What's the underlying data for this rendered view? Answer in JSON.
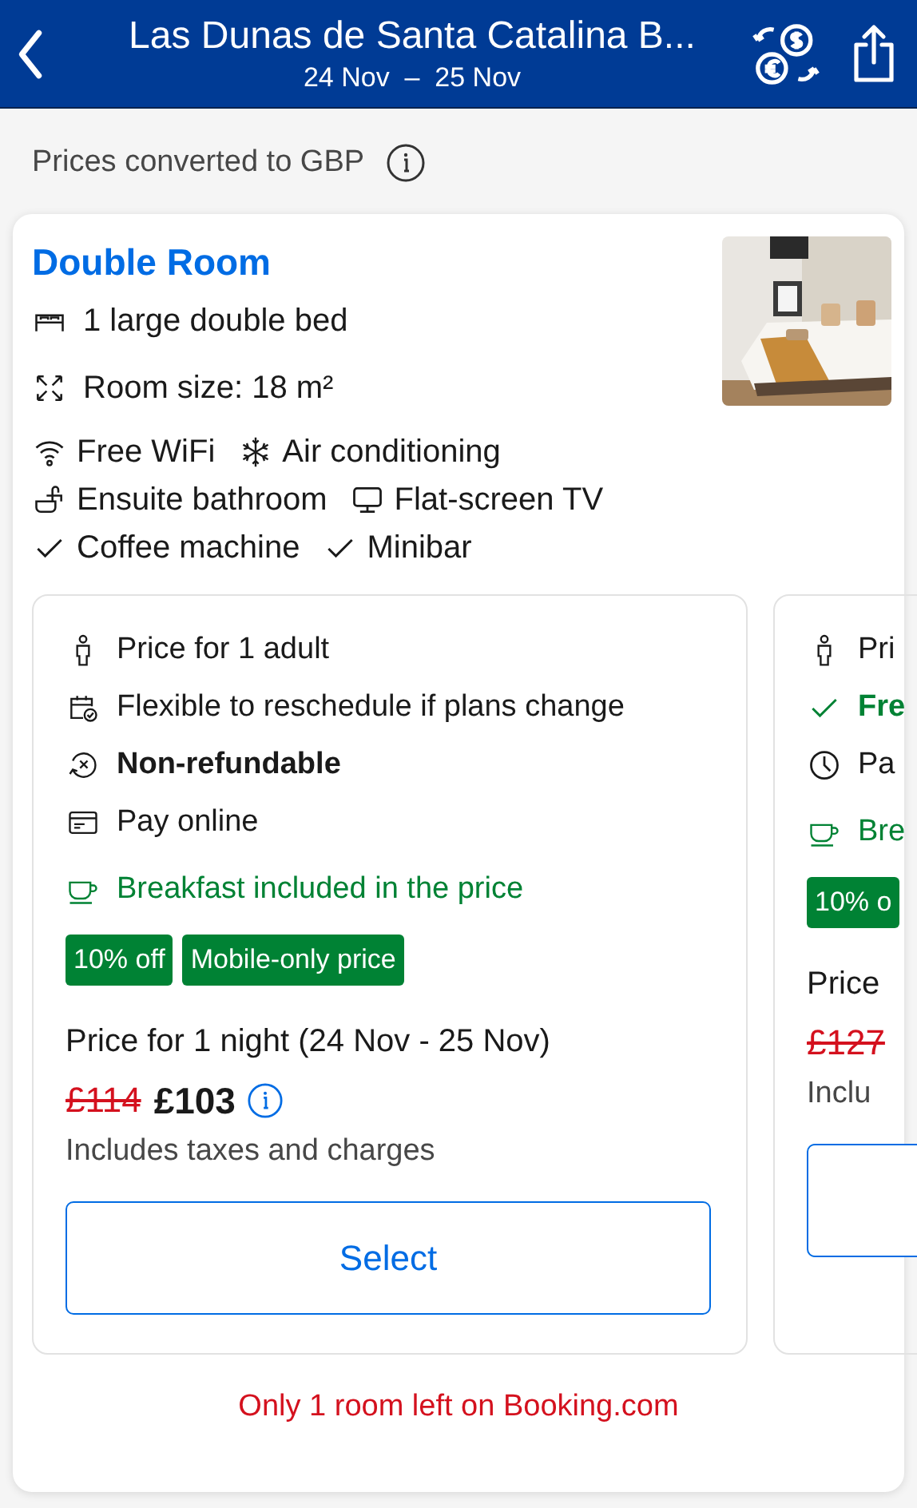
{
  "header": {
    "title": "Las Dunas de Santa Catalina B...",
    "dates": "24 Nov  –  25 Nov"
  },
  "notice": {
    "text": "Prices converted to GBP"
  },
  "room": {
    "name": "Double Room",
    "photo": {
      "kind": "picture"
    },
    "facilities": [
      {
        "kind": "bed",
        "text": "1 large double bed"
      },
      {
        "kind": "size",
        "text": "Room size: 18 m²"
      }
    ],
    "amenity_rows": [
      [
        {
          "kind": "wifi",
          "text": "Free WiFi"
        },
        {
          "kind": "snow",
          "text": "Air conditioning"
        }
      ],
      [
        {
          "kind": "bath",
          "text": "Ensuite bathroom"
        },
        {
          "kind": "tv",
          "text": "Flat-screen TV"
        }
      ],
      [
        {
          "kind": "check",
          "text": "Coffee machine"
        },
        {
          "kind": "check",
          "text": "Minibar"
        }
      ]
    ],
    "offers": [
      {
        "conditions": [
          {
            "kind": "person",
            "text": "Price for 1 adult",
            "bold": false,
            "positive": false
          },
          {
            "kind": "calendar",
            "text": "Flexible to reschedule if plans change",
            "bold": false,
            "positive": false
          },
          {
            "kind": "norefund",
            "text": "Non-refundable",
            "bold": true,
            "positive": false
          },
          {
            "kind": "card",
            "text": "Pay online",
            "bold": false,
            "positive": false
          }
        ],
        "meal": {
          "kind": "cup",
          "text": "Breakfast included in the price"
        },
        "badges": [
          "10% off",
          "Mobile-only price"
        ],
        "price_label": "Price for 1 night (24 Nov - 25 Nov)",
        "old_price": "£114",
        "price": "£103",
        "taxes": "Includes taxes and charges",
        "button": "Select"
      },
      {
        "conditions": [
          {
            "kind": "person",
            "text": "Pri",
            "bold": false,
            "positive": false
          },
          {
            "kind": "check",
            "text": "Fre",
            "bold": true,
            "positive": true
          },
          {
            "kind": "clock",
            "text": "Pa",
            "bold": false,
            "positive": false
          }
        ],
        "meal": {
          "kind": "cup",
          "text": "Bre"
        },
        "badges": [
          "10% o"
        ],
        "price_label": "Price",
        "old_price": "£127",
        "taxes": "Inclu"
      }
    ],
    "availability": "Only 1 room left on Booking.com"
  }
}
